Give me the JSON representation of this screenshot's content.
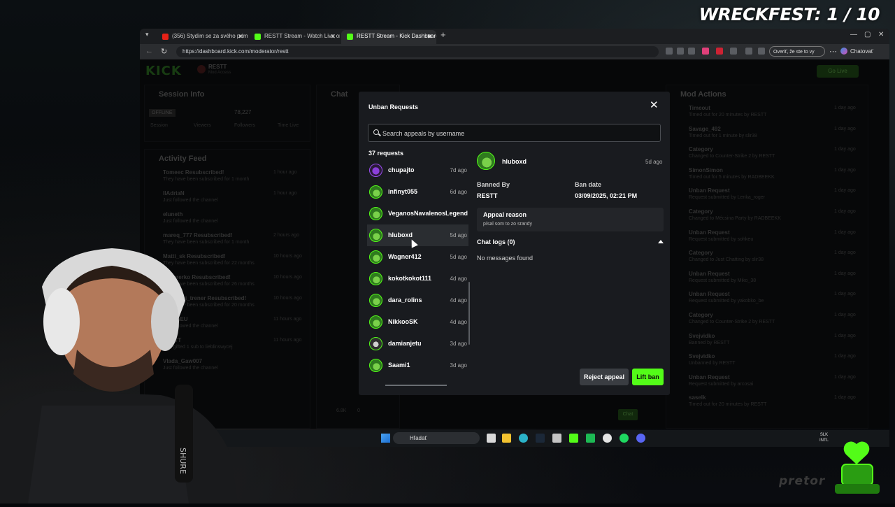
{
  "overlay": {
    "game_counter": "WRECKFEST: 1 / 10",
    "watermark": "pretor"
  },
  "browser": {
    "tabs": [
      {
        "label": "(356) Stydím se za svého primát...",
        "active": false
      },
      {
        "label": "RESTT Stream - Watch Live on Kick",
        "active": false
      },
      {
        "label": "RESTT Stream - Kick Dashboard",
        "active": true
      }
    ],
    "url": "https://dashboard.kick.com/moderator/restt",
    "profile_prompt": "Overiť, že ste to vy",
    "chat_button": "Chatovať"
  },
  "dashboard": {
    "logo": "KICK",
    "channel": "RESTT",
    "role": "Mod Access",
    "go_live": "Go Live",
    "session_info": {
      "title": "Session Info",
      "status": "OFFLINE",
      "followers_value": "78,227",
      "labels": [
        "Session",
        "Viewers",
        "Followers",
        "Time Live"
      ]
    },
    "chat_title": "Chat",
    "activity_feed": {
      "title": "Activity Feed",
      "items": [
        {
          "name": "Tomeec Resubscribed!",
          "sub": "They have been subscribed for 1 month",
          "time": "1 hour ago"
        },
        {
          "name": "llAdriaN",
          "sub": "Just followed the channel",
          "time": "1 hour ago"
        },
        {
          "name": "eluneth",
          "sub": "Just followed the channel",
          "time": ""
        },
        {
          "name": "mareq_777 Resubscribed!",
          "sub": "They have been subscribed for 1 month",
          "time": "2 hours ago"
        },
        {
          "name": "Matti_sk Resubscribed!",
          "sub": "They have been subscribed for 22 months",
          "time": "10 hours ago"
        },
        {
          "name": "Pedererko Resubscribed!",
          "sub": "They have been subscribed for 26 months",
          "time": "10 hours ago"
        },
        {
          "name": "Kundicni_trener Resubscribed!",
          "sub": "They have been subscribed for 20 months",
          "time": "10 hours ago"
        },
        {
          "name": "SimonEU",
          "sub": "Just followed the channel",
          "time": "11 hours ago"
        },
        {
          "name": "RESTT",
          "sub": "Just gifted 1 sub to lieblinswycej",
          "time": "11 hours ago"
        },
        {
          "name": "Vlada_Gaw007",
          "sub": "Just followed the channel",
          "time": ""
        }
      ]
    },
    "mod_actions": {
      "title": "Mod Actions",
      "items": [
        {
          "title": "Timeout",
          "sub": "Timed out for 20 minutes by RESTT",
          "time": "1 day ago"
        },
        {
          "title": "Savage_492",
          "sub": "Timed out for 1 minute by slir38",
          "time": "1 day ago"
        },
        {
          "title": "Category",
          "sub": "Changed to Counter-Strike 2 by RESTT",
          "time": "1 day ago"
        },
        {
          "title": "SimonSimon",
          "sub": "Timed out for 5 minutes by RADBEEKK",
          "time": "1 day ago"
        },
        {
          "title": "Unban Request",
          "sub": "Request submitted by Lenka_roger",
          "time": "1 day ago"
        },
        {
          "title": "Category",
          "sub": "Changed to Mécsina Party by RADBEEKK",
          "time": "1 day ago"
        },
        {
          "title": "Unban Request",
          "sub": "Request submitted by sohkeu",
          "time": "1 day ago"
        },
        {
          "title": "Category",
          "sub": "Changed to Just Chatting by slir38",
          "time": "1 day ago"
        },
        {
          "title": "Unban Request",
          "sub": "Request submitted by Miko_38",
          "time": "1 day ago"
        },
        {
          "title": "Unban Request",
          "sub": "Request submitted by yakobko_be",
          "time": "1 day ago"
        },
        {
          "title": "Category",
          "sub": "Changed to Counter-Strike 2 by RESTT",
          "time": "1 day ago"
        },
        {
          "title": "Svejvidko",
          "sub": "Banned by RESTT",
          "time": "1 day ago"
        },
        {
          "title": "Svejvidko",
          "sub": "Unbanned by RESTT",
          "time": "1 day ago"
        },
        {
          "title": "Unban Request",
          "sub": "Request submitted by arcosai",
          "time": "1 day ago"
        },
        {
          "title": "saselk",
          "sub": "Timed out for 20 minutes by RESTT",
          "time": "1 day ago"
        }
      ]
    },
    "chat_footer": {
      "viewers": "6.8K",
      "count": "0",
      "send": "Chat"
    }
  },
  "modal": {
    "title": "Unban Requests",
    "search_placeholder": "Search appeals by username",
    "count_label": "37 requests",
    "requests": [
      {
        "username": "chupajto",
        "time": "7d ago",
        "avatar": "purple"
      },
      {
        "username": "infinyt055",
        "time": "6d ago",
        "avatar": "green"
      },
      {
        "username": "VeganosNavalenosLegend",
        "time": "",
        "avatar": "green"
      },
      {
        "username": "hluboxd",
        "time": "5d ago",
        "avatar": "green",
        "selected": true
      },
      {
        "username": "Wagner412",
        "time": "5d ago",
        "avatar": "green"
      },
      {
        "username": "kokotkokot111",
        "time": "4d ago",
        "avatar": "green"
      },
      {
        "username": "dara_rolins",
        "time": "4d ago",
        "avatar": "green"
      },
      {
        "username": "NikkooSK",
        "time": "4d ago",
        "avatar": "green"
      },
      {
        "username": "damianjetu",
        "time": "3d ago",
        "avatar": "dark"
      },
      {
        "username": "Saami1",
        "time": "3d ago",
        "avatar": "green"
      }
    ],
    "detail": {
      "username": "hluboxd",
      "time": "5d ago",
      "banned_by_label": "Banned By",
      "banned_by": "RESTT",
      "ban_date_label": "Ban date",
      "ban_date": "03/09/2025, 02:21 PM",
      "appeal_title": "Appeal reason",
      "appeal_text": "písal som to zo srandy",
      "chat_logs_label": "Chat logs (0)",
      "no_messages": "No messages found"
    },
    "reject_label": "Reject appeal",
    "lift_label": "Lift ban"
  },
  "taskbar": {
    "search_text": "Hľadať",
    "lang": "SLK",
    "lang2": "INTL"
  },
  "colors": {
    "kick_green": "#53fc18",
    "modal_bg": "#191b1f",
    "page_bg": "#0b0d0f"
  }
}
